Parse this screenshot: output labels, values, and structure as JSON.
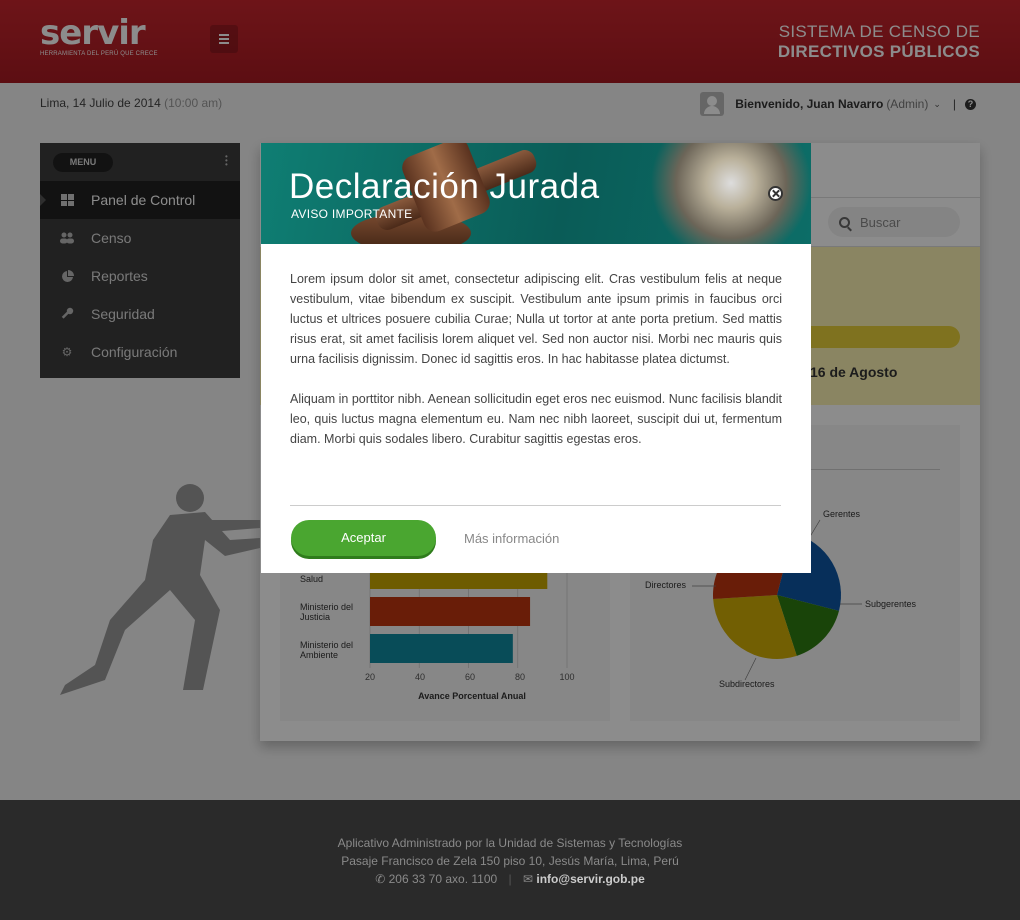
{
  "header": {
    "logo_text": "servir",
    "logo_tagline": "HERRAMIENTA DEL PERÚ QUE CRECE",
    "system_title_line1": "SISTEMA DE CENSO  DE",
    "system_title_line2": "DIRECTIVOS PÚBLICOS"
  },
  "subbar": {
    "date": "Lima, 14 Julio de 2014",
    "time": "(10:00 am)",
    "welcome": "Bienvenido, Juan Navarro",
    "role": "(Admin)",
    "separator": "|",
    "help_icon": "?"
  },
  "sidebar": {
    "menu_label": "MENU",
    "items": [
      {
        "label": "Panel de Control",
        "icon": "windows-icon",
        "active": true
      },
      {
        "label": "Censo",
        "icon": "users-icon"
      },
      {
        "label": "Reportes",
        "icon": "pie-chart-icon"
      },
      {
        "label": "Seguridad",
        "icon": "key-icon"
      },
      {
        "label": "Configuración",
        "icon": "gear-icon"
      }
    ]
  },
  "main": {
    "search_placeholder": "Buscar",
    "notice_date": "16 de Agosto"
  },
  "bar_chart": {
    "rows": [
      {
        "label_l1": "Salud",
        "label_l2": ""
      },
      {
        "label_l1": "Ministerio del",
        "label_l2": "Justicia"
      },
      {
        "label_l1": "Ministerio del",
        "label_l2": "Ambiente"
      }
    ],
    "ticks": [
      "20",
      "40",
      "60",
      "80",
      "100"
    ],
    "xlabel": "Avance Porcentual Anual"
  },
  "pie_chart": {
    "labels": [
      "Gerentes",
      "Subgerentes",
      "Subdirectores",
      "Directores"
    ]
  },
  "chart_data": [
    {
      "type": "bar",
      "orientation": "horizontal",
      "categories": [
        "Salud",
        "Ministerio del Justicia",
        "Ministerio del Ambiente"
      ],
      "values": [
        92,
        85,
        78
      ],
      "colors": [
        "#c8a800",
        "#c0360f",
        "#0f8aa0"
      ],
      "xlabel": "Avance Porcentual Anual",
      "xlim": [
        20,
        100
      ]
    },
    {
      "type": "pie",
      "categories": [
        "Gerentes",
        "Subgerentes",
        "Subdirectores",
        "Directores"
      ],
      "values": [
        25,
        16,
        29,
        30
      ],
      "colors": [
        "#0d57a5",
        "#2e7d12",
        "#d0ae06",
        "#c0360f"
      ]
    }
  ],
  "modal": {
    "title": "Declaración Jurada",
    "subtitle": "AVISO IMPORTANTE",
    "paragraph1": "Lorem ipsum dolor sit amet, consectetur adipiscing elit. Cras vestibulum felis at neque vestibulum, vitae bibendum ex suscipit. Vestibulum ante ipsum primis in faucibus orci luctus et ultrices posuere cubilia Curae; Nulla ut tortor at ante porta pretium. Sed mattis risus erat, sit amet facilisis lorem aliquet vel. Sed non auctor nisi. Morbi nec mauris quis urna facilisis dignissim. Donec id sagittis eros. In hac habitasse platea dictumst.",
    "paragraph2": "Aliquam in porttitor nibh. Aenean sollicitudin eget eros nec euismod. Nunc facilisis blandit leo, quis luctus magna elementum eu. Nam nec nibh laoreet, suscipit dui ut, fermentum diam. Morbi quis sodales libero. Curabitur sagittis egestas eros.",
    "accept_label": "Aceptar",
    "more_label": "Más información"
  },
  "footer": {
    "line1": "Aplicativo Administrado por la Unidad de Sistemas y Tecnologías",
    "line2": "Pasaje Francisco de Zela 150 piso 10, Jesús María, Lima, Perú",
    "phone": "206 33 70 axo. 1100",
    "email": "info@servir.gob.pe"
  }
}
